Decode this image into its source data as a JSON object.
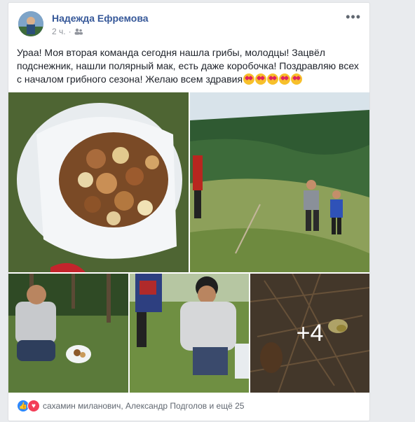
{
  "post": {
    "author": "Надежда Ефремова",
    "time": "2 ч.",
    "audience_icon": "friends-icon",
    "text": "Ураа! Моя вторая команда сегодня нашла грибы, молодцы! Зацвёл подснежник, нашли полярный мак, есть даже коробочка! Поздравляю всех с началом грибного сезона! Желаю всем здравия",
    "more_photos": "+4"
  },
  "reactions": {
    "summary": "сахамин миланович, Александр Подголов и ещё 25"
  }
}
